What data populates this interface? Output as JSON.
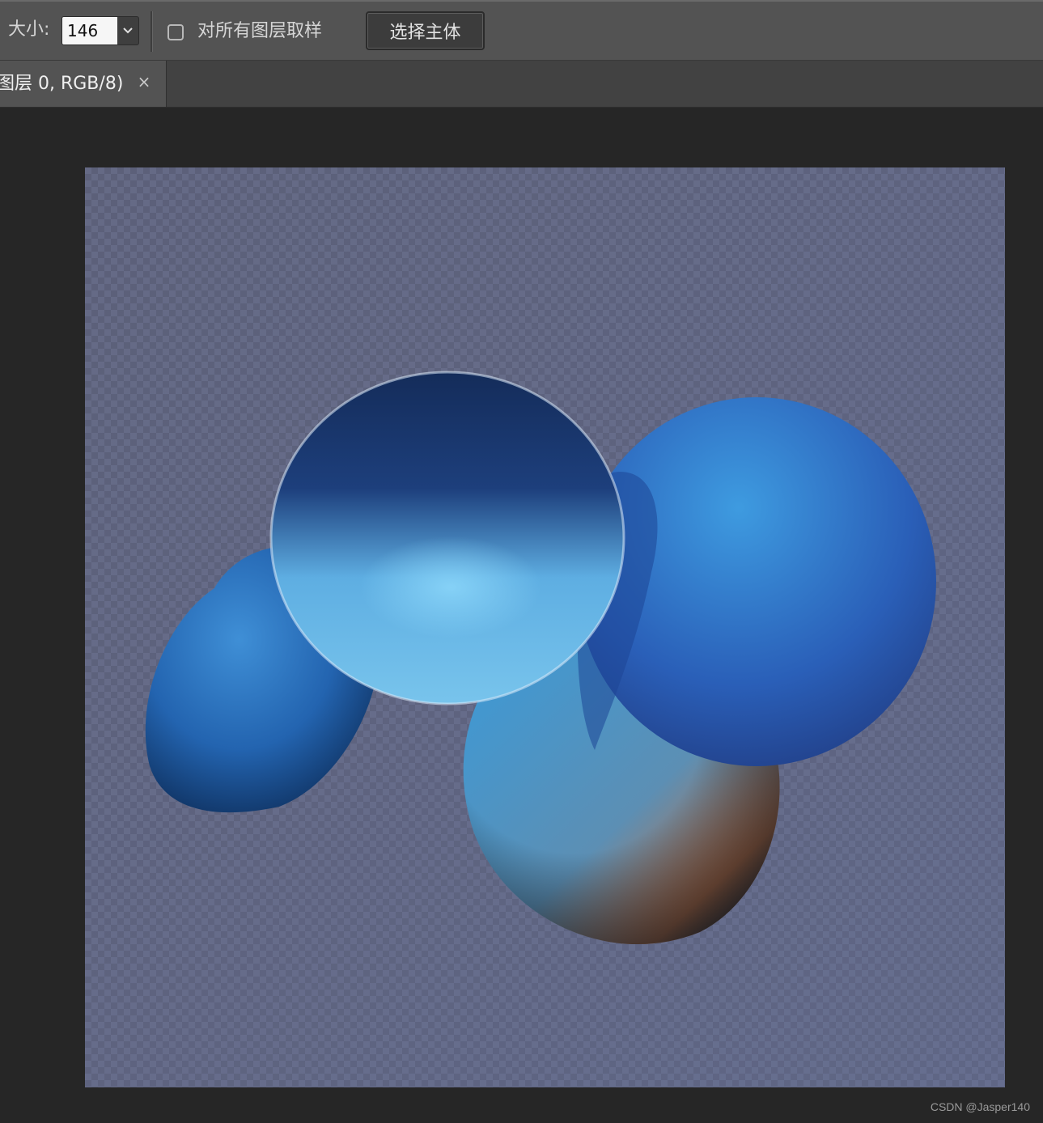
{
  "options_bar": {
    "size_label": "大小:",
    "size_value": "146",
    "sample_all_layers_label": "对所有图层取样",
    "sample_all_layers_checked": false,
    "select_subject_label": "选择主体"
  },
  "tabs": [
    {
      "title": "图层 0, RGB/8)",
      "close_glyph": "×",
      "active": true
    }
  ],
  "watermark": "CSDN @Jasper140",
  "icons": {
    "dropdown": "chevron-down-icon",
    "close": "close-icon"
  },
  "colors": {
    "options_bar_bg": "#535353",
    "canvas_bg": "#262626",
    "transparency_grid": "#656a85"
  }
}
